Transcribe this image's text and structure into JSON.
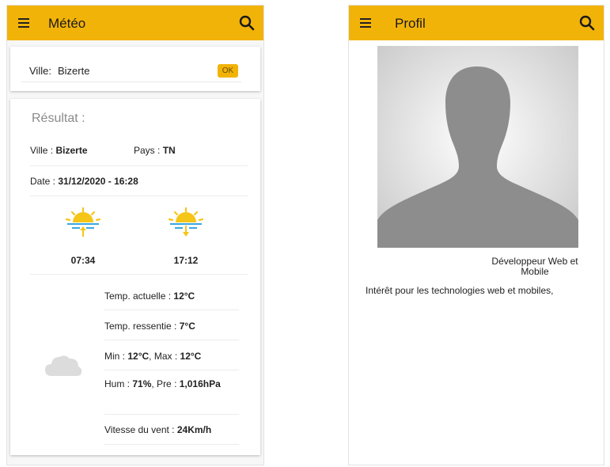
{
  "meteo": {
    "title": "Météo",
    "city_label": "Ville:",
    "city_value": "Bizerte",
    "ok_label": "OK",
    "result_title": "Résultat :",
    "ville_label": "Ville :",
    "ville_value": "Bizerte",
    "pays_label": "Pays :",
    "pays_value": "TN",
    "date_label": "Date :",
    "date_value": "31/12/2020 - 16:28",
    "sunrise": "07:34",
    "sunset": "17:12",
    "temp_actuelle_label": "Temp. actuelle :",
    "temp_actuelle_value": "12°C",
    "temp_ressentie_label": "Temp. ressentie :",
    "temp_ressentie_value": "7°C",
    "min_label": "Min :",
    "min_value": "12°C",
    "max_label": ", Max :",
    "max_value": "12°C",
    "hum_label": "Hum :",
    "hum_value": "71%",
    "pre_label": ", Pre :",
    "pre_value": "1,016hPa",
    "vent_label": "Vitesse du vent :",
    "vent_value": "24Km/h",
    "icons": [
      "menu-icon",
      "search-icon",
      "sunrise-icon",
      "sunset-icon",
      "cloud-icon"
    ]
  },
  "profil": {
    "title": "Profil",
    "role": "Développeur Web et Mobile",
    "bio": "Intérêt pour les technologies web et mobiles,",
    "icons": [
      "menu-icon",
      "search-icon",
      "avatar-silhouette-icon"
    ]
  },
  "colors": {
    "appbar": "#f2b309",
    "sun": "#f5c518",
    "water": "#3aa7e0",
    "cloud": "#dcdcdc"
  }
}
